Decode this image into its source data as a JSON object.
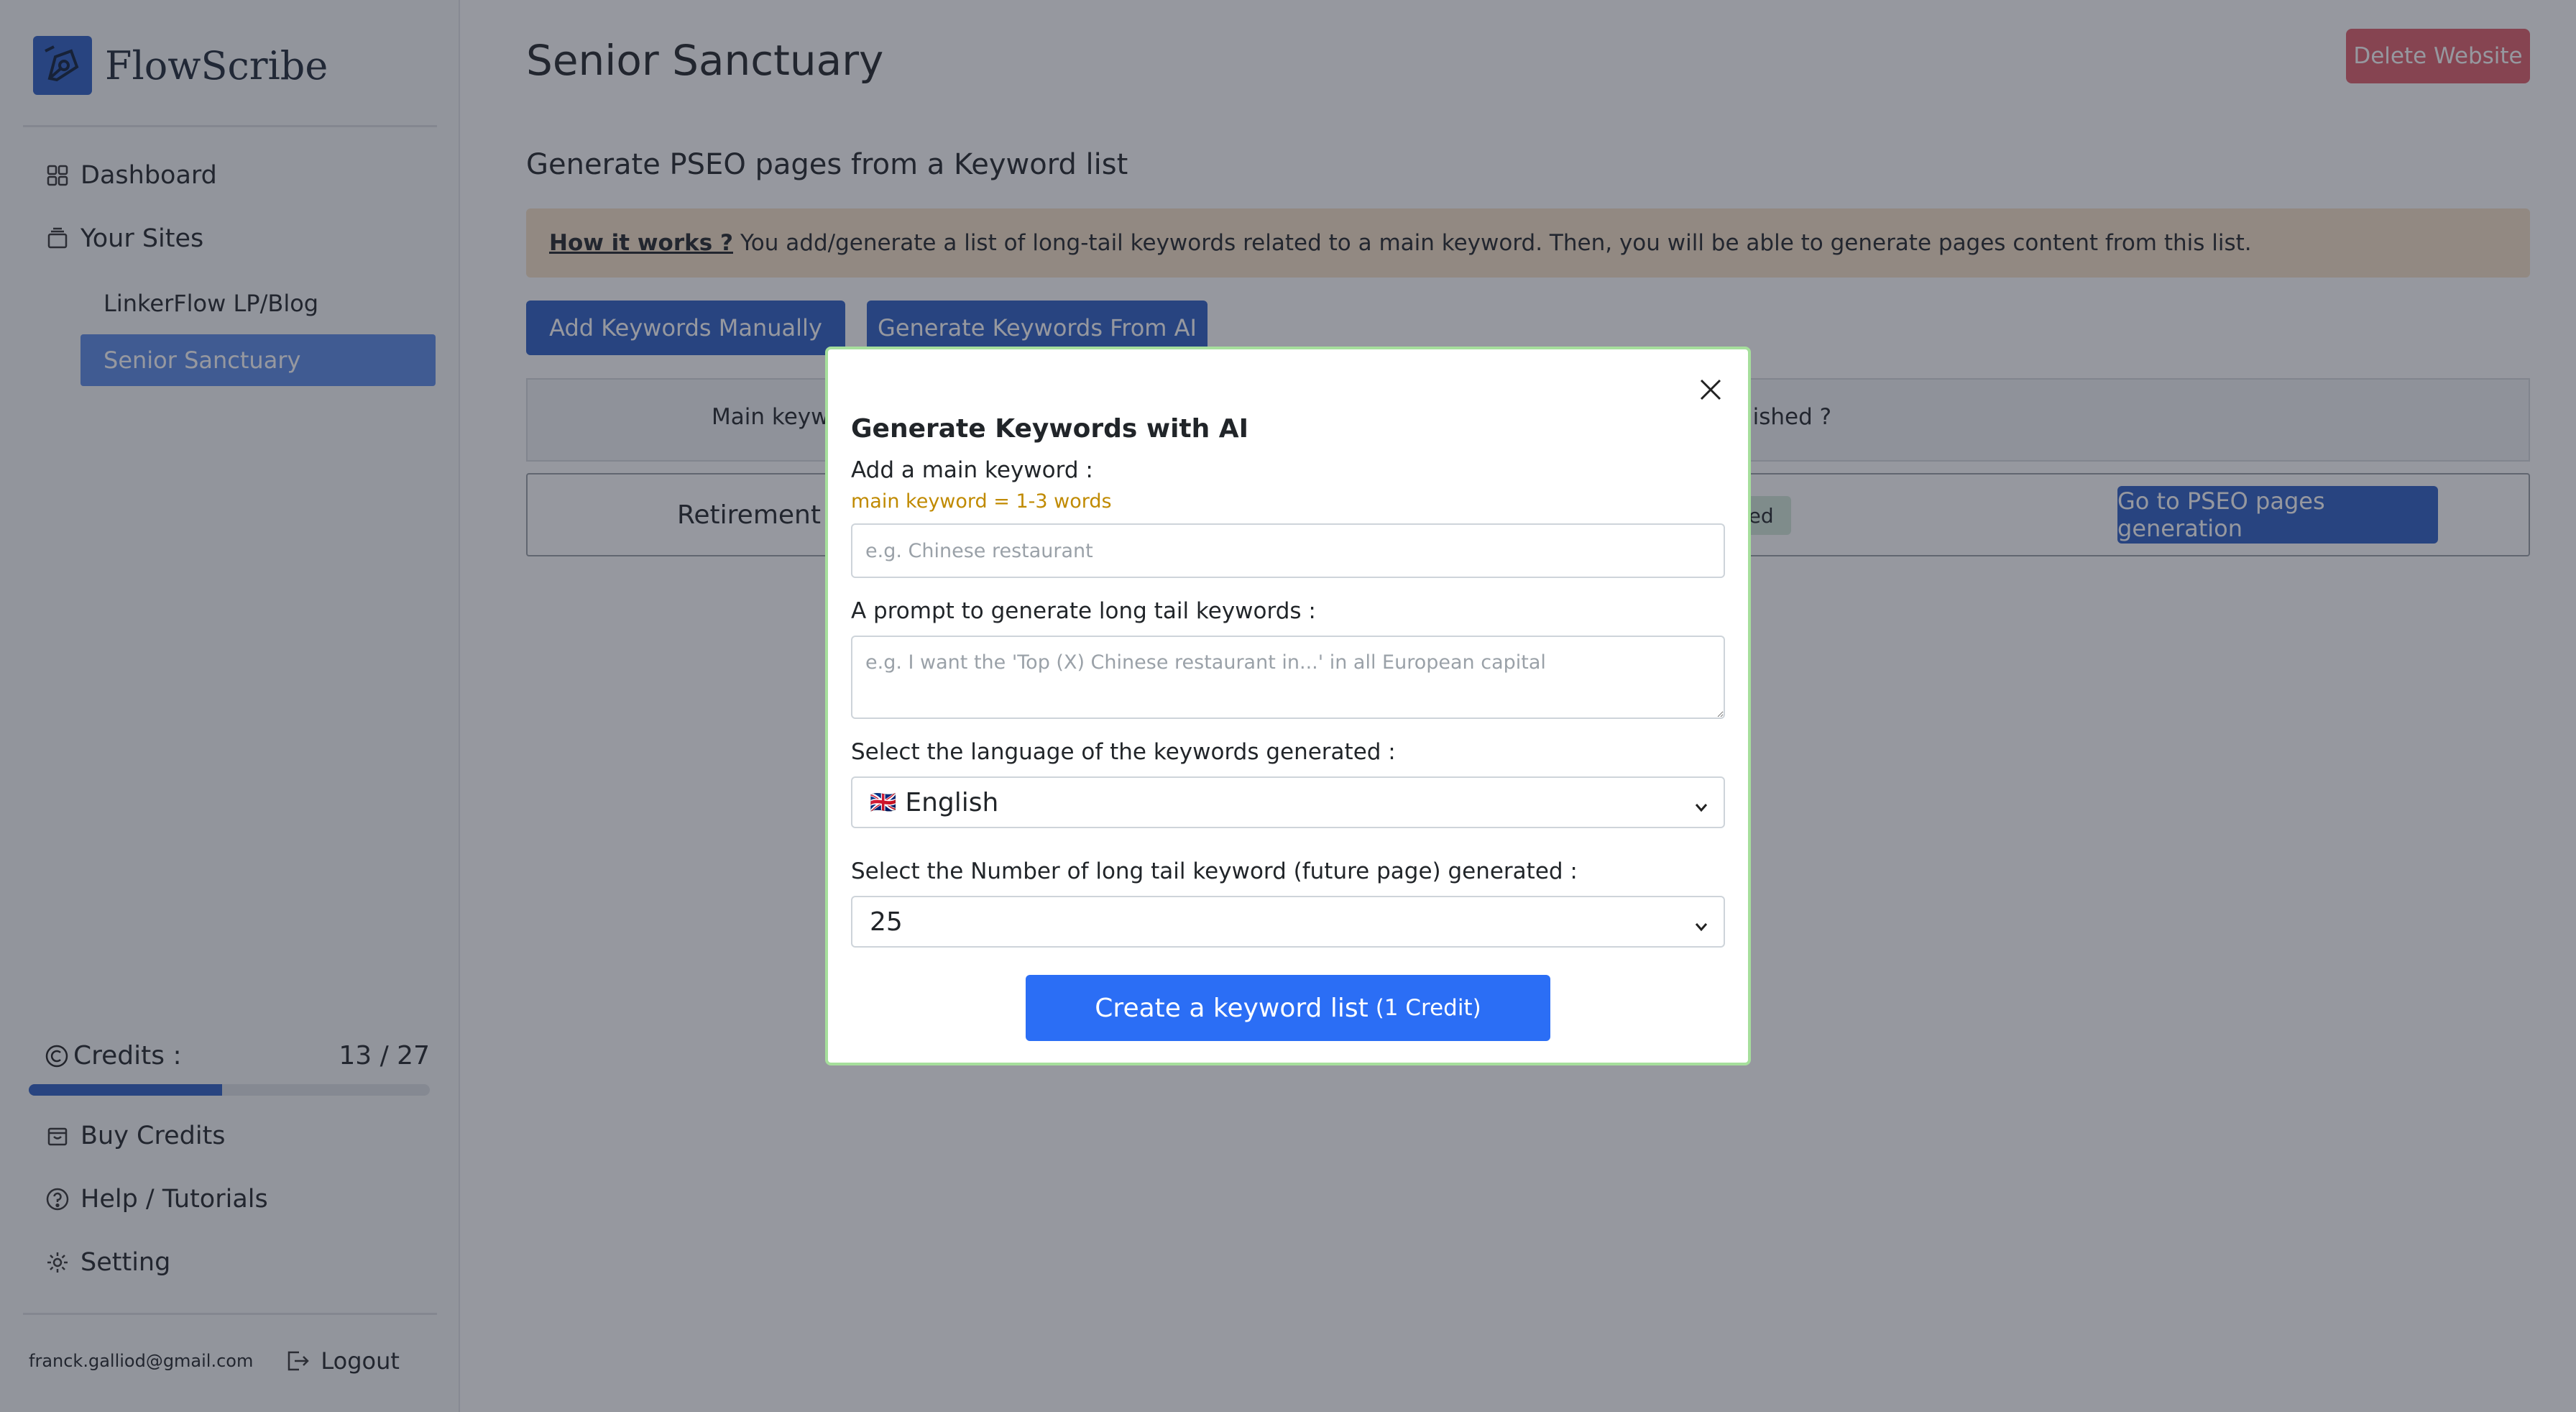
{
  "app": {
    "name": "FlowScribe"
  },
  "sidebar": {
    "nav": [
      {
        "label": "Dashboard",
        "icon": "grid-icon"
      },
      {
        "label": "Your Sites",
        "icon": "stack-icon"
      }
    ],
    "sites": [
      {
        "label": "LinkerFlow LP/Blog",
        "active": false
      },
      {
        "label": "Senior Sanctuary",
        "active": true
      }
    ],
    "credits": {
      "label": "Credits :",
      "display": "13 / 27",
      "used": 13,
      "total": 27
    },
    "bottom_nav": [
      {
        "label": "Buy Credits",
        "icon": "bag-icon"
      },
      {
        "label": "Help / Tutorials",
        "icon": "question-icon"
      },
      {
        "label": "Setting",
        "icon": "gear-icon"
      }
    ],
    "user_email": "franck.galliod@gmail.com",
    "logout_label": "Logout"
  },
  "main": {
    "title": "Senior Sanctuary",
    "delete_label": "Delete Website",
    "section_title": "Generate PSEO pages from a Keyword list",
    "how": {
      "link": "How it works ?",
      "text": "You add/generate a list of long-tail keywords related to a main keyword. Then, you will be able to generate pages content from this list."
    },
    "buttons": {
      "manual": "Add Keywords Manually",
      "ai": "Generate Keywords From AI"
    },
    "table": {
      "headers": [
        "Main keyw",
        "lished ?"
      ],
      "row": {
        "keyword": "Retirement h",
        "status": "s published",
        "action": "Go to PSEO pages generation"
      }
    }
  },
  "modal": {
    "title": "Generate Keywords with AI",
    "main_label": "Add a main keyword :",
    "main_hint": "main keyword = 1-3 words",
    "main_placeholder": "e.g. Chinese restaurant",
    "prompt_label": "A prompt to generate long tail keywords :",
    "prompt_placeholder": "e.g. I want the 'Top (X) Chinese restaurant in...' in all European capital",
    "lang_label": "Select the language of the keywords generated :",
    "lang_flag": "🇬🇧",
    "lang_value": "English",
    "count_label": "Select the Number of long tail keyword (future page) generated :",
    "count_value": "25",
    "create_label": "Create a keyword list",
    "create_sub": "(1 Credit)"
  },
  "colors": {
    "primary": "#2d5fc4",
    "danger": "#e05f6a",
    "info": "#f7e3c7",
    "accent_hint": "#c08a00",
    "modal_border": "#a6df9c",
    "create": "#2b6ef5"
  }
}
